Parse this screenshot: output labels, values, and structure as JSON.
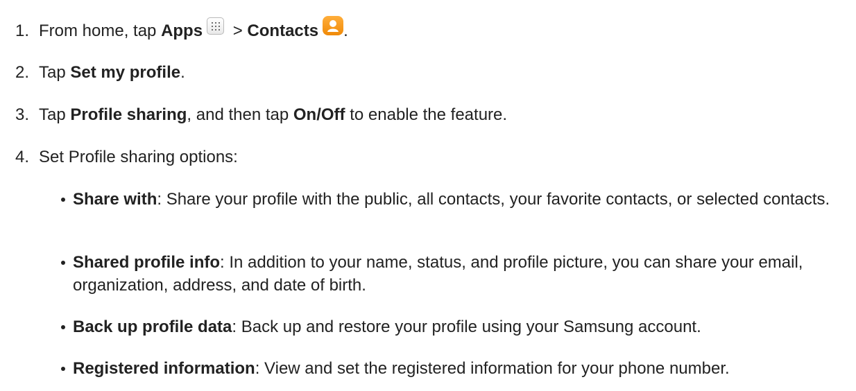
{
  "steps": [
    {
      "num": "1.",
      "prefix": "From home, tap ",
      "apps_label": "Apps",
      "separator": " > ",
      "contacts_label": "Contacts",
      "suffix": ".",
      "apps_icon": "apps-grid-icon",
      "contacts_icon": "contacts-person-icon"
    },
    {
      "num": "2.",
      "prefix": "Tap ",
      "bold": "Set my profile",
      "suffix": "."
    },
    {
      "num": "3.",
      "prefix": "Tap ",
      "bold1": "Profile sharing",
      "middle": ", and then tap ",
      "bold2": "On/Off",
      "suffix": " to enable the feature."
    },
    {
      "num": "4.",
      "text": "Set Profile sharing options:"
    }
  ],
  "options": [
    {
      "term": "Share with",
      "desc": ": Share your profile with the public, all contacts, your favorite contacts, or selected contacts."
    },
    {
      "term": "Shared profile info",
      "desc": ": In addition to your name, status, and profile picture, you can share your email, organization, address, and date of birth."
    },
    {
      "term": "Back up profile data",
      "desc": ": Back up and restore your profile using your Samsung account."
    },
    {
      "term": "Registered information",
      "desc": ": View and set the registered information for your phone number."
    }
  ],
  "colors": {
    "text": "#222222",
    "contacts_icon": "#f39514",
    "apps_icon_border": "#b9b9b9"
  }
}
